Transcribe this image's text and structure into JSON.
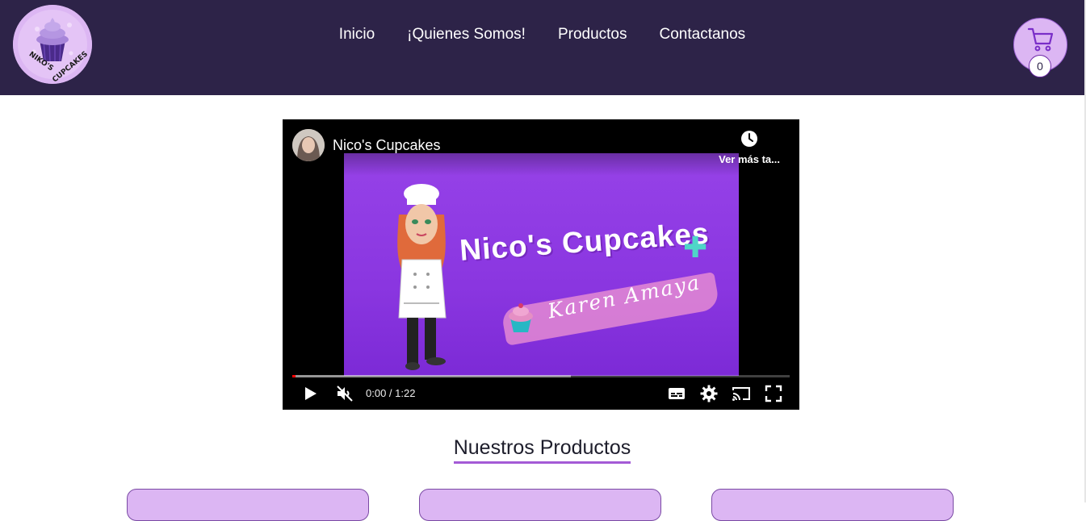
{
  "brand": {
    "logo_text": "NIKO'S CUPCAKES"
  },
  "nav": {
    "items": [
      {
        "label": "Inicio"
      },
      {
        "label": "¡Quienes Somos!"
      },
      {
        "label": "Productos"
      },
      {
        "label": "Contactanos"
      }
    ]
  },
  "cart": {
    "count": "0",
    "icon": "cart-icon"
  },
  "video": {
    "channel_title": "Nico's Cupcakes",
    "watch_later_label": "Ver más ta...",
    "thumbnail_title": "Nico's Cupcakes",
    "thumbnail_subtitle": "Karen Amaya",
    "time": "0:00 / 1:22",
    "progress_fraction": 0.0,
    "buffered_fraction": 0.56,
    "controls": [
      "play-icon",
      "mute-icon",
      "subtitles-icon",
      "settings-icon",
      "cast-icon",
      "fullscreen-icon"
    ]
  },
  "products": {
    "title": "Nuestros Productos",
    "cards": 3
  },
  "colors": {
    "navbar": "#2d2348",
    "accent": "#dcb6f3",
    "underline": "#a45ad6",
    "thumbnail_purple": "#9642e8"
  }
}
